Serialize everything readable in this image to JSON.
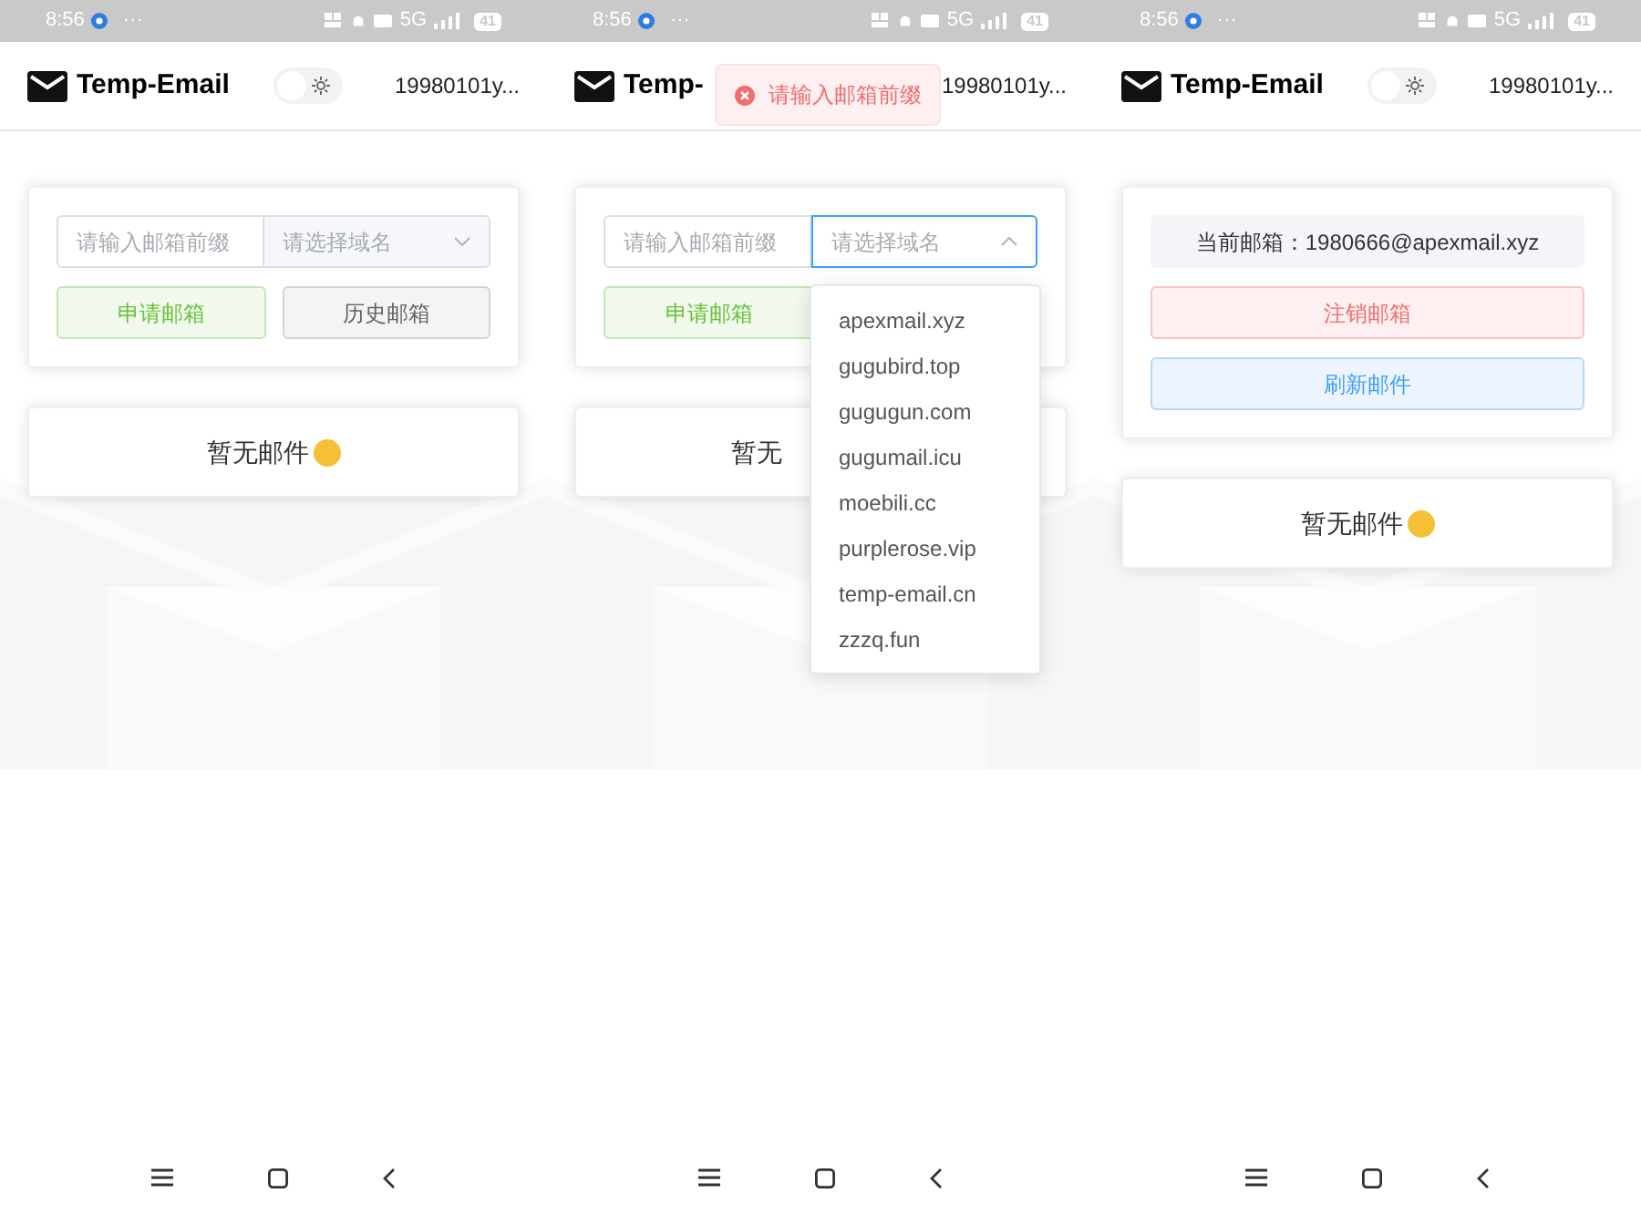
{
  "screens": [
    {
      "status_bar": {
        "time": "8:56",
        "more": "···",
        "network": "5G",
        "battery": "41"
      },
      "header": {
        "title": "Temp-Email",
        "theme_switch": {
          "on": false
        },
        "user": "19980101y..."
      },
      "panel": {
        "kind": "form",
        "prefix_field": {
          "placeholder": "请输入邮箱前缀"
        },
        "domain_select": {
          "placeholder": "请选择域名",
          "open": false
        },
        "buttons": [
          {
            "label": "申请邮箱",
            "kind": "success"
          },
          {
            "label": "历史邮箱",
            "kind": "default"
          }
        ]
      },
      "inbox": {
        "empty_text": "暂无邮件"
      }
    },
    {
      "status_bar": {
        "time": "8:56",
        "more": "···",
        "network": "5G",
        "battery": "41"
      },
      "header": {
        "title": "Temp-",
        "user": "19980101y..."
      },
      "toast": {
        "kind": "error",
        "text": "请输入邮箱前缀"
      },
      "panel": {
        "kind": "form",
        "prefix_field": {
          "placeholder": "请输入邮箱前缀"
        },
        "domain_select": {
          "placeholder": "请选择域名",
          "open": true
        },
        "buttons": [
          {
            "label": "申请邮箱",
            "kind": "success"
          }
        ]
      },
      "domain_options": [
        {
          "label": "apexmail.xyz",
          "selected": false
        },
        {
          "label": "gugubird.top",
          "selected": false
        },
        {
          "label": "gugugun.com",
          "selected": false
        },
        {
          "label": "gugumail.icu",
          "selected": false
        },
        {
          "label": "moebili.cc",
          "selected": false
        },
        {
          "label": "purplerose.vip",
          "selected": false
        },
        {
          "label": "temp-email.cn",
          "selected": false
        },
        {
          "label": "zzzq.fun",
          "selected": false
        }
      ],
      "inbox": {
        "empty_text": "暂无"
      }
    },
    {
      "status_bar": {
        "time": "8:56",
        "more": "···",
        "network": "5G",
        "battery": "41"
      },
      "header": {
        "title": "Temp-Email",
        "theme_switch": {
          "on": false
        },
        "user": "19980101y..."
      },
      "panel": {
        "kind": "current",
        "current_email": "当前邮箱：1980666@apexmail.xyz",
        "buttons": [
          {
            "label": "注销邮箱",
            "kind": "danger"
          },
          {
            "label": "刷新邮件",
            "kind": "primary"
          }
        ]
      },
      "inbox": {
        "empty_text": "暂无邮件"
      }
    }
  ]
}
